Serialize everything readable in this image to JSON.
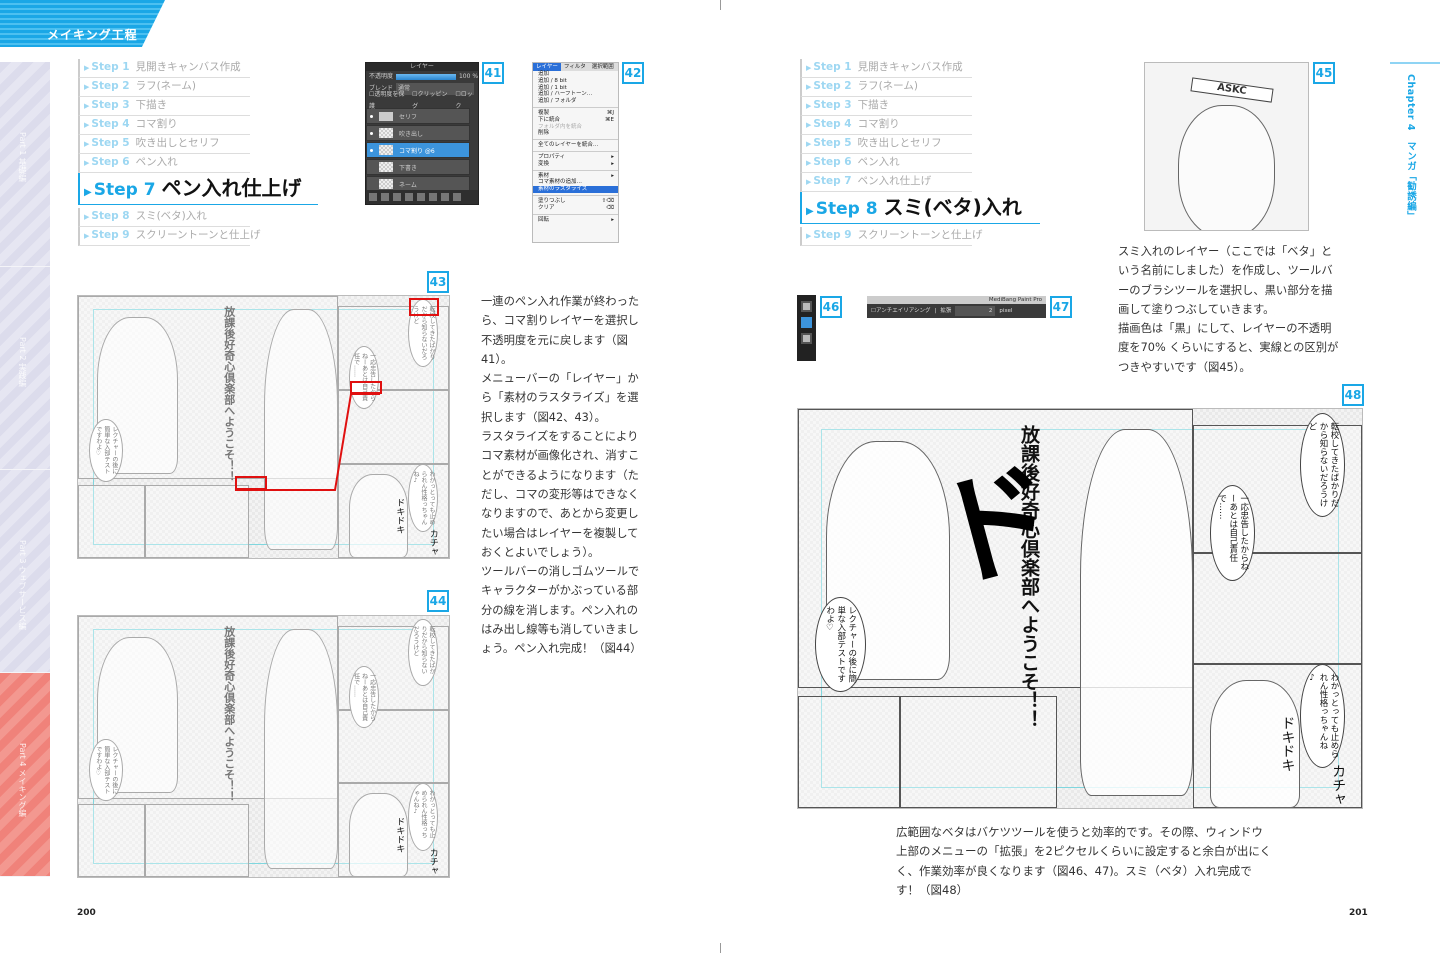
{
  "header": {
    "section_title": "メイキング工程"
  },
  "side_tabs": [
    {
      "label": "Part 1 基礎編",
      "active": false
    },
    {
      "label": "Part 2 実践編",
      "active": false
    },
    {
      "label": "Part 3 ウェブサービス編",
      "active": false
    },
    {
      "label": "Part 4 メイキング編",
      "active": true
    }
  ],
  "steps": [
    {
      "num": "Step 1",
      "label": "見開きキャンバス作成"
    },
    {
      "num": "Step 2",
      "label": "ラフ(ネーム)"
    },
    {
      "num": "Step 3",
      "label": "下描き"
    },
    {
      "num": "Step 4",
      "label": "コマ割り"
    },
    {
      "num": "Step 5",
      "label": "吹き出しとセリフ"
    },
    {
      "num": "Step 6",
      "label": "ペン入れ"
    },
    {
      "num": "Step 7",
      "label": "ペン入れ仕上げ"
    },
    {
      "num": "Step 8",
      "label": "スミ(ベタ)入れ"
    },
    {
      "num": "Step 9",
      "label": "スクリーントーンと仕上げ"
    }
  ],
  "left_page": {
    "current_step": 7,
    "page_number": "200",
    "paragraphs": [
      "一連のペン入れ作業が終わったら、コマ割りレイヤーを選択し不透明度を元に戻します（図41）。",
      "メニューバーの「レイヤー」から「素材のラスタライズ」を選択します（図42、43）。",
      "ラスタライズをすることによりコマ素材が画像化され、消すことができるようになります（ただし、コマの変形等はできなくなりますので、あとから変更したい場合はレイヤーを複製しておくとよいでしょう）。",
      "ツールバーの消しゴムツールでキャラクターがかぶっている部分の線を消します。ペン入れのはみ出し線等も消していきましょう。ペン入れ完成！（図44）"
    ]
  },
  "right_page": {
    "current_step": 8,
    "page_number": "201",
    "paragraphs": [
      "スミ入れのレイヤー（ここでは「ベタ」という名前にしました）を作成し、ツールバーのブラシツールを選択し、黒い部分を描画して塗りつぶしていきます。",
      "描画色は「黒」にして、レイヤーの不透明度を70% くらいにすると、実線との区別がつきやすいです（図45）。"
    ],
    "bottom_text": "広範囲なベタはバケツツールを使うと効率的です。その際、ウィンドウ上部のメニューの「拡張」を2ピクセルくらいに設定すると余白が出にくく、作業効率が良くなります（図46、47)。スミ（ベタ）入れ完成です！（図48）",
    "chapter_tab": "Chapter 4　マンガ「勧誘編」"
  },
  "figures": {
    "f41": "41",
    "f42": "42",
    "f43": "43",
    "f44": "44",
    "f45": "45",
    "f46": "46",
    "f47": "47",
    "f48": "48"
  },
  "layer_panel": {
    "title": "レイヤー",
    "opacity_label": "不透明度",
    "opacity_value": "100 %",
    "opacity": 1.0,
    "blend_label": "ブレンド",
    "blend_value": "通常",
    "checks": [
      "透明度を保護",
      "クリッピング",
      "ロック"
    ],
    "layers": [
      {
        "name": "セリフ",
        "type": "folder"
      },
      {
        "name": "吹き出し"
      },
      {
        "name": "コマ割り @6",
        "selected": true
      },
      {
        "name": "下書き"
      },
      {
        "name": "ネーム"
      }
    ]
  },
  "layer_menu": {
    "tabs": [
      "レイヤー",
      "フィルタ",
      "選択範囲"
    ],
    "items": [
      {
        "label": "追加"
      },
      {
        "label": "追加 / 8 bit"
      },
      {
        "label": "追加 / 1 bit"
      },
      {
        "label": "追加 / ハーフトーン…"
      },
      {
        "label": "追加 / フォルダ"
      },
      {
        "sep": true
      },
      {
        "label": "複製",
        "shortcut": "⌘J"
      },
      {
        "label": "下に統合",
        "shortcut": "⌘E"
      },
      {
        "label": "フォルダ内を統合",
        "disabled": true
      },
      {
        "label": "削除"
      },
      {
        "sep": true
      },
      {
        "label": "全てのレイヤーを統合…"
      },
      {
        "sep": true
      },
      {
        "label": "プロパティ",
        "shortcut": "▸"
      },
      {
        "label": "変換",
        "shortcut": "▸"
      },
      {
        "sep": true
      },
      {
        "label": "素材",
        "shortcut": "▸"
      },
      {
        "label": "コマ素材の追加…"
      },
      {
        "label": "素材のラスタライズ",
        "highlighted": true
      },
      {
        "sep": true
      },
      {
        "label": "塗りつぶし",
        "shortcut": "⇧⌫"
      },
      {
        "label": "クリア",
        "shortcut": "⌫"
      },
      {
        "sep": true
      },
      {
        "label": "回転",
        "shortcut": "▸"
      }
    ]
  },
  "tool_options": {
    "app_title": "MediBang Paint Pro",
    "antialias": "アンチエイリアシング",
    "expand_label": "拡張",
    "expand_value": "2",
    "unit": "pixel"
  },
  "manga": {
    "title": "放課後好奇心倶楽部へようこそ！！",
    "bubble_1": "転校してきたばかりだから知らないだろうけど",
    "bubble_2": "一応忠告したからねーあとは自己責任で……",
    "bubble_3": "レクチャーの後に簡単な入部テストですわよ♡",
    "bubble_4": "わかっとっても止められん性格っちゃんね♪",
    "sfx_1": "ドキドキ",
    "sfx_2": "カチャ",
    "sfx_do": "ド",
    "headband": "ASKC"
  },
  "colors": {
    "accent": "#1aa7e6",
    "part4": "#f0827a",
    "annotation_red": "#e01010"
  }
}
